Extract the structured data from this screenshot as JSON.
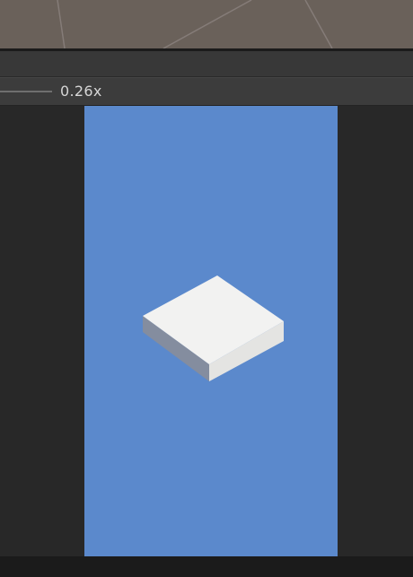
{
  "scale": {
    "label": "0.26x"
  },
  "viewport": {
    "background_color": "#5b89cc"
  },
  "cube": {
    "top_color": "#f2f2f1",
    "right_color": "#e4e4e2",
    "left_color": "#848d9f"
  },
  "scene": {
    "background_color": "#6a615a",
    "grid_color": "#8a8280"
  }
}
